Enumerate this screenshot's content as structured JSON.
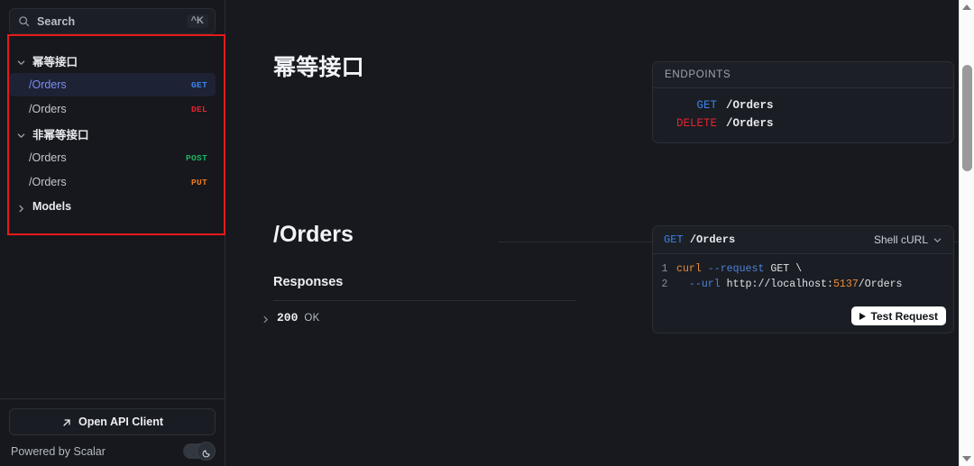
{
  "sidebar": {
    "search": {
      "placeholder": "Search",
      "shortcut": "^K",
      "icon": "search-icon"
    },
    "groups": [
      {
        "label": "幂等接口",
        "expanded": true,
        "chevron": "chevron-down-icon",
        "items": [
          {
            "path": "/Orders",
            "method": "GET",
            "method_color": "#3c82e8",
            "active": true
          },
          {
            "path": "/Orders",
            "method": "DEL",
            "method_color": "#e0252f",
            "active": false
          }
        ]
      },
      {
        "label": "非幂等接口",
        "expanded": true,
        "chevron": "chevron-down-icon",
        "items": [
          {
            "path": "/Orders",
            "method": "POST",
            "method_color": "#1eb561",
            "active": false
          },
          {
            "path": "/Orders",
            "method": "PUT",
            "method_color": "#ee7a20",
            "active": false
          }
        ]
      },
      {
        "label": "Models",
        "expanded": false,
        "chevron": "chevron-right-icon",
        "items": []
      }
    ],
    "footer": {
      "api_client_label": "Open API Client",
      "api_client_icon": "arrow-up-right-icon",
      "powered_by": "Powered by Scalar",
      "theme_toggle_icon": "moon-icon",
      "theme_toggle_on": true
    }
  },
  "main": {
    "section_title": "幂等接口",
    "endpoints_panel": {
      "header": "ENDPOINTS",
      "rows": [
        {
          "method": "GET",
          "method_color": "#3c82e8",
          "path": "/Orders"
        },
        {
          "method": "DELETE",
          "method_color": "#e0252f",
          "path": "/Orders"
        }
      ]
    },
    "operation": {
      "title": "/Orders",
      "responses_heading": "Responses",
      "responses": [
        {
          "code": "200",
          "text": "OK",
          "chevron": "chevron-right-icon"
        }
      ]
    },
    "code_sample": {
      "method": "GET",
      "path": "/Orders",
      "language_label": "Shell cURL",
      "language_chevron": "chevron-down-icon",
      "lines": [
        {
          "number": "1",
          "tokens": [
            {
              "t": "curl",
              "c": "cmd"
            },
            {
              "t": " ",
              "c": "plain"
            },
            {
              "t": "--request",
              "c": "flag"
            },
            {
              "t": " GET \\",
              "c": "plain"
            }
          ]
        },
        {
          "number": "2",
          "tokens": [
            {
              "t": "  ",
              "c": "plain"
            },
            {
              "t": "--url",
              "c": "flag"
            },
            {
              "t": " http://localhost:",
              "c": "plain"
            },
            {
              "t": "5137",
              "c": "num"
            },
            {
              "t": "/Orders",
              "c": "plain"
            }
          ]
        }
      ],
      "test_button_label": "Test Request",
      "test_button_icon": "play-icon"
    }
  },
  "scrollbar": {
    "up_arrow_icon": "triangle-up-icon",
    "down_arrow_icon": "triangle-down-icon"
  },
  "annotation": {
    "color": "#e81a1a"
  }
}
